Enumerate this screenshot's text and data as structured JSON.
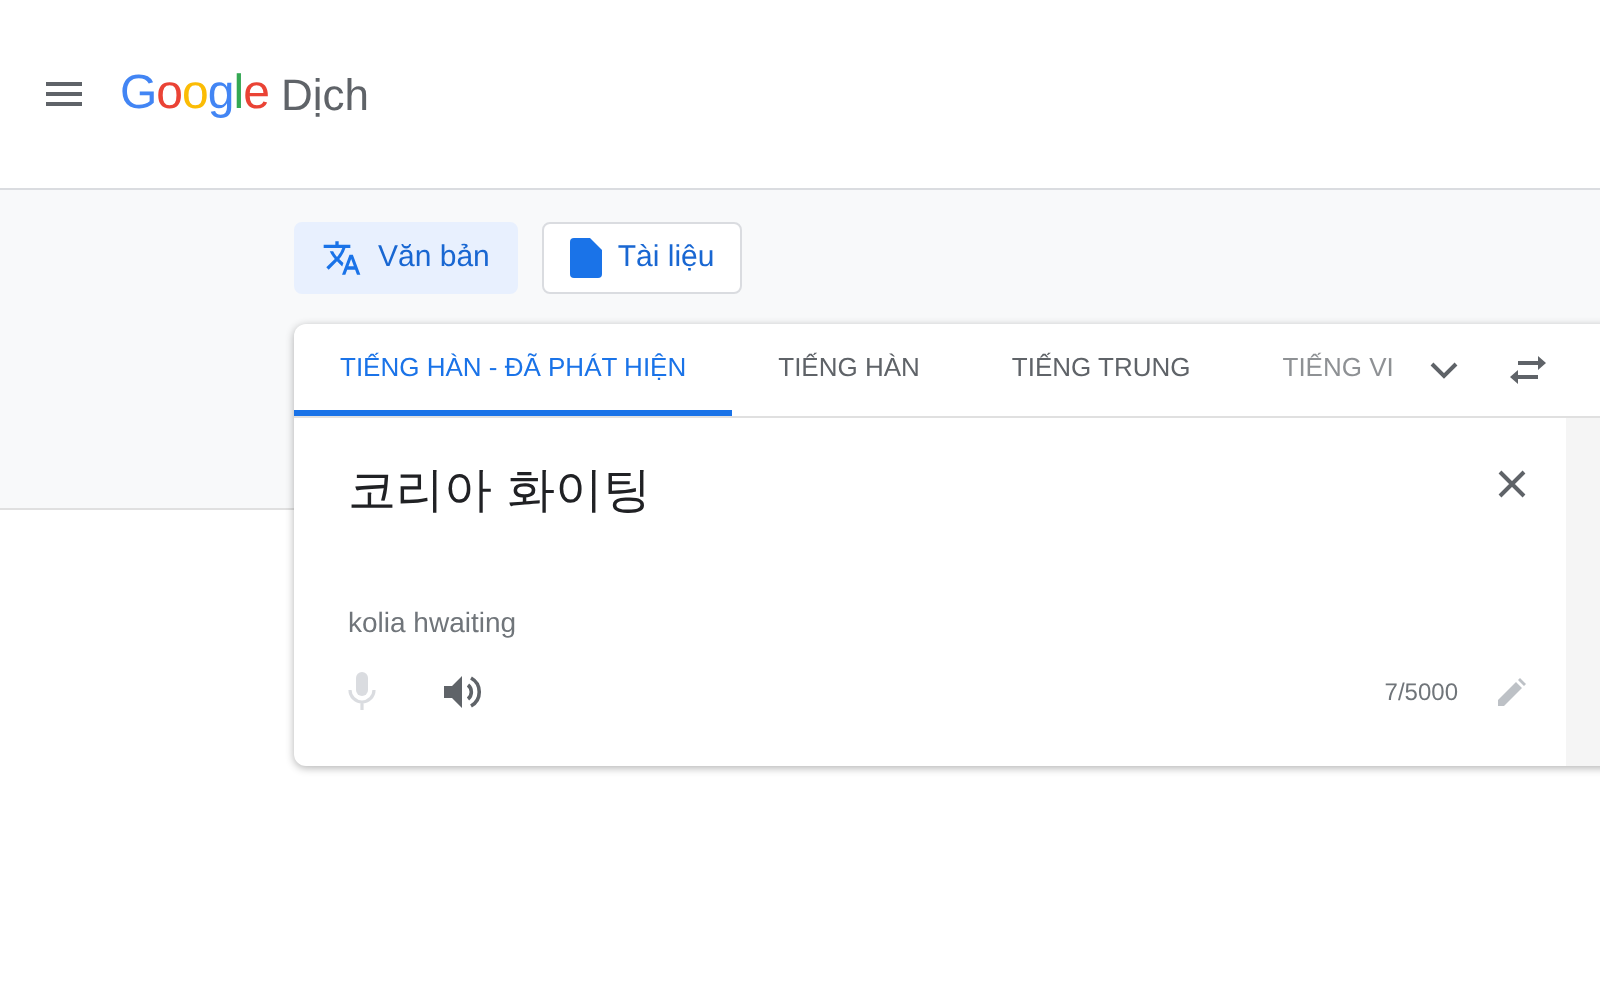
{
  "header": {
    "logo": "Google",
    "app_name": "Dịch"
  },
  "modes": [
    {
      "label": "Văn bản",
      "kind": "text",
      "selected": true
    },
    {
      "label": "Tài liệu",
      "kind": "document",
      "selected": false
    }
  ],
  "language_tabs": [
    {
      "label": "TIẾNG HÀN - ĐÃ PHÁT HIỆN",
      "selected": true
    },
    {
      "label": "TIẾNG HÀN",
      "selected": false
    },
    {
      "label": "TIẾNG TRUNG",
      "selected": false
    },
    {
      "label": "TIẾNG VI",
      "selected": false
    }
  ],
  "source": {
    "value": "코리아 화이팅",
    "romanization": "kolia hwaiting",
    "char_count": "7/5000",
    "mic_disabled": true
  }
}
